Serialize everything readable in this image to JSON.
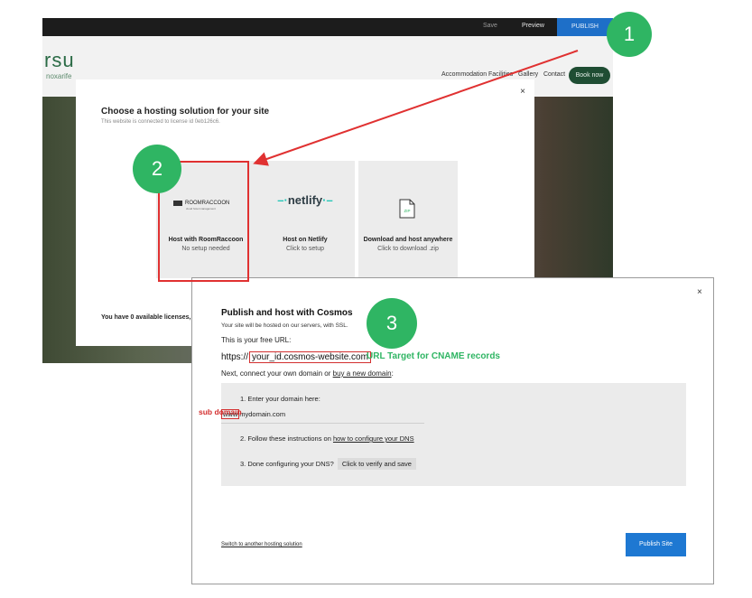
{
  "background_screenshot": {
    "topbar": {
      "save": "Save",
      "preview": "Preview",
      "publish": "PUBLISH"
    },
    "site": {
      "logo": "rsu",
      "logo_sub": "noxarife",
      "nav": [
        "Accommodation",
        "Facilities",
        "Gallery",
        "Contact"
      ],
      "book_button": "Book now"
    }
  },
  "hosting_modal": {
    "close": "×",
    "title": "Choose a hosting solution for your site",
    "subtitle": "This website is connected to license id 0eb126c6.",
    "cards": [
      {
        "logo_text": "ROOMRACCOON",
        "logo_tagline": "cloud hotel management",
        "title": "Host with RoomRaccoon",
        "subtitle": "No setup needed"
      },
      {
        "logo_text": "netlify",
        "title": "Host on Netlify",
        "subtitle": "Click to setup"
      },
      {
        "icon_label": "ZIP",
        "title": "Download and host anywhere",
        "subtitle": "Click to download .zip"
      }
    ],
    "footer": "You have 0 available licenses, g"
  },
  "cosmos_modal": {
    "close": "×",
    "title": "Publish and host with Cosmos",
    "subtitle": "Your site will be hosted on our servers, with SSL.",
    "free_url_label": "This is your free URL:",
    "url_prefix": "https://",
    "url_value": "your_id.cosmos-website.com",
    "connect_text": "Next, connect your own domain or ",
    "connect_link": "buy a new domain",
    "connect_suffix": ":",
    "step1": "1. Enter your domain here:",
    "domain_www": "www",
    "domain_rest": "mydomain.com",
    "step2_text": "2. Follow these instructions on ",
    "step2_link": "how to configure your DNS",
    "step3_text": "3. Done configuring your DNS?",
    "verify_button": "Click to verify and save",
    "switch_link": "Switch to another hosting solution",
    "publish_button": "Publish Site"
  },
  "annotations": {
    "step1": "1",
    "step2": "2",
    "step3": "3",
    "url_target_label": "URL Target for CNAME records",
    "subdomain_label": "sub domain",
    "colors": {
      "green": "#2fb563",
      "red": "#e03131",
      "publish_blue": "#1e78d2"
    }
  }
}
